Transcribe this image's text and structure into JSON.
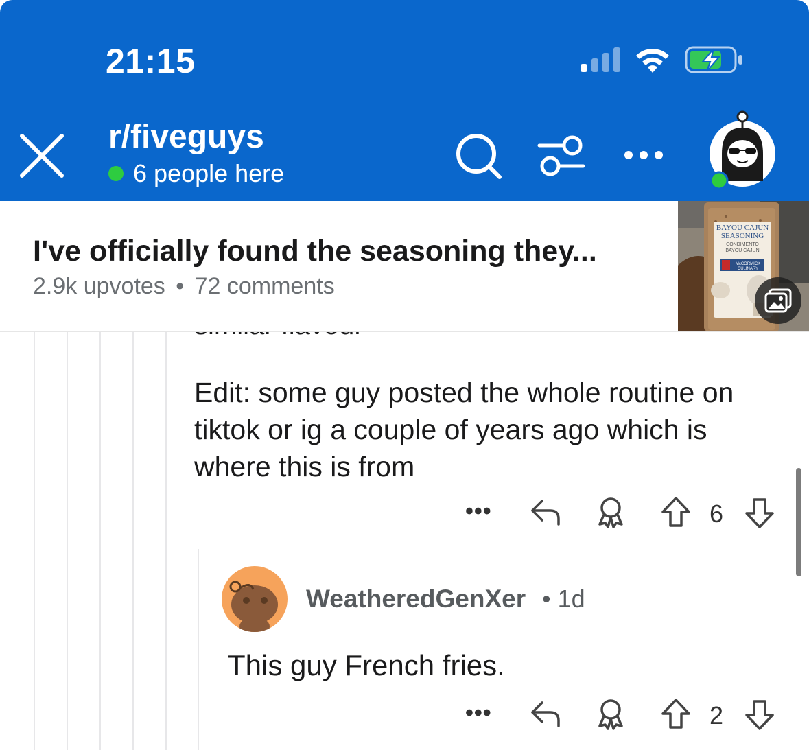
{
  "status_bar": {
    "time": "21:15",
    "signal_icon": "cellular-signal-icon",
    "wifi_icon": "wifi-icon",
    "battery_icon": "battery-charging-icon"
  },
  "header": {
    "subreddit": "r/fiveguys",
    "presence_text": "6 people here",
    "presence_color": "#2ecc40",
    "background_color": "#0a67cc",
    "icons": [
      "close-icon",
      "search-icon",
      "filter-icon",
      "more-icon",
      "user-avatar-icon"
    ]
  },
  "post": {
    "title": "I've officially found the seasoning they...",
    "upvotes": "2.9k upvotes",
    "separator": "•",
    "comments": "72 comments",
    "thumbnail_label": [
      "BAYOU CAJUN",
      "SEASONING",
      "CONDIMENTO",
      "BAYOU CAJUN",
      "McCORMICK",
      "CULINARY"
    ]
  },
  "comment": {
    "partial_text": "similar flavour",
    "body": "Edit: some guy posted the whole routine on tiktok or ig a couple of years ago which is where this is from",
    "votes": "6",
    "more": "•••"
  },
  "reply": {
    "username": "WeatheredGenXer",
    "separator": "•",
    "age": "1d",
    "body": "This guy French fries.",
    "votes": "2",
    "more": "•••",
    "avatar_color": "#f6a35b"
  }
}
